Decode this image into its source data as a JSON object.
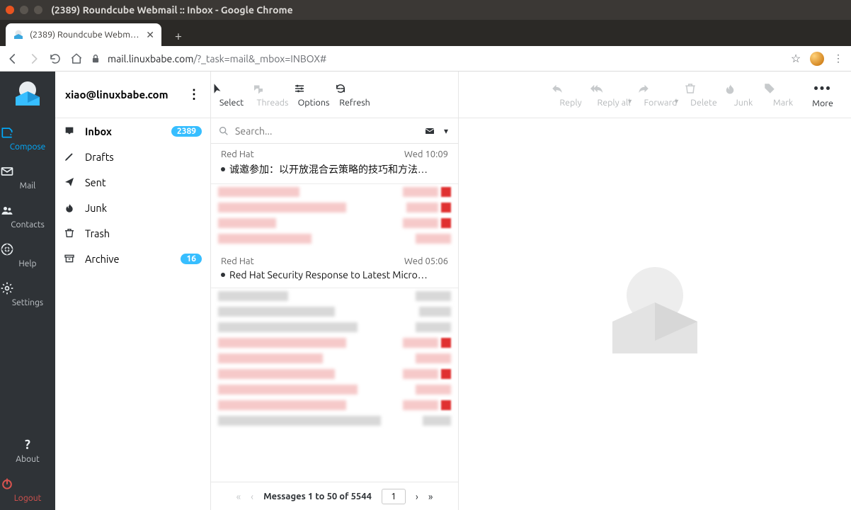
{
  "os": {
    "window_title": "(2389) Roundcube Webmail :: Inbox - Google Chrome"
  },
  "browser": {
    "tab_title": "(2389) Roundcube Webm…",
    "url_host": "mail.linuxbabe.com",
    "url_path": "/?_task=mail&_mbox=INBOX#"
  },
  "rail": {
    "compose": "Compose",
    "mail": "Mail",
    "contacts": "Contacts",
    "help": "Help",
    "settings": "Settings",
    "about": "About",
    "logout": "Logout"
  },
  "account": {
    "email": "xiao@linuxbabe.com"
  },
  "folders": [
    {
      "name": "Inbox",
      "icon": "inbox",
      "active": true,
      "badge": "2389"
    },
    {
      "name": "Drafts",
      "icon": "pencil",
      "active": false,
      "badge": ""
    },
    {
      "name": "Sent",
      "icon": "send",
      "active": false,
      "badge": ""
    },
    {
      "name": "Junk",
      "icon": "fire",
      "active": false,
      "badge": ""
    },
    {
      "name": "Trash",
      "icon": "trash",
      "active": false,
      "badge": ""
    },
    {
      "name": "Archive",
      "icon": "archive",
      "active": false,
      "badge": "16"
    }
  ],
  "list_toolbar": {
    "select": "Select",
    "threads": "Threads",
    "options": "Options",
    "refresh": "Refresh"
  },
  "search": {
    "placeholder": "Search..."
  },
  "messages": [
    {
      "from": "Red Hat",
      "date": "Wed 10:09",
      "subject": "诚邀参加：以开放混合云策略的技巧和方法…",
      "unread": true
    },
    {
      "from": "Red Hat",
      "date": "Wed 05:06",
      "subject": "Red Hat Security Response to Latest Micro…",
      "unread": true
    }
  ],
  "pager": {
    "text": "Messages 1 to 50 of 5544",
    "page": "1"
  },
  "preview_toolbar": {
    "reply": "Reply",
    "reply_all": "Reply all",
    "forward": "Forward",
    "delete": "Delete",
    "junk": "Junk",
    "mark": "Mark",
    "more": "More"
  }
}
